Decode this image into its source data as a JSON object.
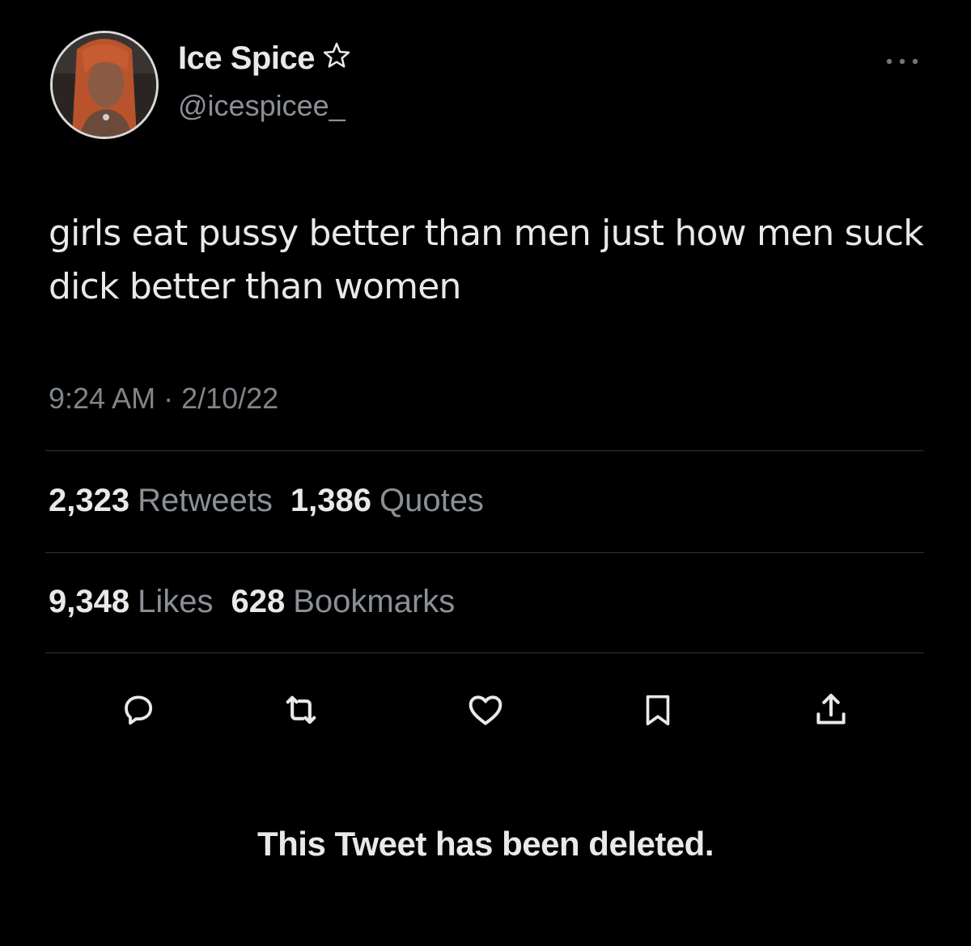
{
  "author": {
    "display_name": "Ice Spice",
    "handle": "@icespicee_",
    "badge_icon": "star-outline-icon",
    "avatar": "profile-photo"
  },
  "header": {
    "more_icon": "more-horizontal-icon"
  },
  "tweet": {
    "text": "girls eat pussy better than men just how men suck dick better than women",
    "timestamp": "9:24 AM · 2/10/22"
  },
  "stats": {
    "retweets": {
      "count": "2,323",
      "label": "Retweets"
    },
    "quotes": {
      "count": "1,386",
      "label": "Quotes"
    },
    "likes": {
      "count": "9,348",
      "label": "Likes"
    },
    "bookmarks": {
      "count": "628",
      "label": "Bookmarks"
    }
  },
  "actions": [
    {
      "name": "reply",
      "icon": "reply-icon"
    },
    {
      "name": "retweet",
      "icon": "retweet-icon"
    },
    {
      "name": "like",
      "icon": "heart-icon"
    },
    {
      "name": "bookmark",
      "icon": "bookmark-icon"
    },
    {
      "name": "share",
      "icon": "share-icon"
    }
  ],
  "notice": "This Tweet has been deleted.",
  "colors": {
    "background": "#000000",
    "text_primary": "#e7e9ea",
    "text_secondary": "#8b9096",
    "divider": "#2f3336"
  }
}
